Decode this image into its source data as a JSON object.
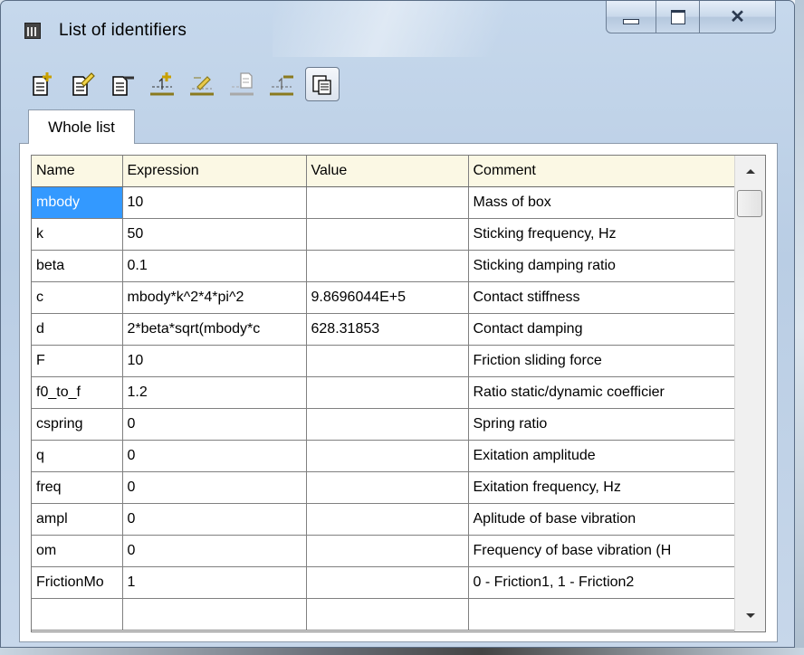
{
  "window": {
    "title": "List of identifiers",
    "controls": [
      "minimize-icon",
      "maximize-icon",
      "close-icon"
    ]
  },
  "toolbar": {
    "buttons": [
      {
        "icon": "add-document-icon"
      },
      {
        "icon": "edit-document-icon"
      },
      {
        "icon": "remove-document-icon"
      },
      {
        "icon": "add-row-icon"
      },
      {
        "icon": "edit-row-icon"
      },
      {
        "icon": "copy-row-icon"
      },
      {
        "icon": "remove-row-icon"
      },
      {
        "icon": "paste-icon",
        "pressed": true
      }
    ]
  },
  "tabs": [
    {
      "label": "Whole list"
    }
  ],
  "grid": {
    "columns": [
      "Name",
      "Expression",
      "Value",
      "Comment"
    ],
    "rows": [
      {
        "name": "mbody",
        "expression": "10",
        "value": "",
        "comment": "Mass of box",
        "selected": true
      },
      {
        "name": "k",
        "expression": "50",
        "value": "",
        "comment": "Sticking frequency, Hz"
      },
      {
        "name": "beta",
        "expression": "0.1",
        "value": "",
        "comment": "Sticking damping ratio"
      },
      {
        "name": "c",
        "expression": "mbody*k^2*4*pi^2",
        "value": "9.8696044E+5",
        "comment": "Contact stiffness"
      },
      {
        "name": "d",
        "expression": "2*beta*sqrt(mbody*c",
        "value": "628.31853",
        "comment": "Contact damping"
      },
      {
        "name": "F",
        "expression": "10",
        "value": "",
        "comment": "Friction sliding force"
      },
      {
        "name": "f0_to_f",
        "expression": "1.2",
        "value": "",
        "comment": "Ratio static/dynamic coefficier"
      },
      {
        "name": "cspring",
        "expression": "0",
        "value": "",
        "comment": "Spring ratio"
      },
      {
        "name": "q",
        "expression": "0",
        "value": "",
        "comment": "Exitation amplitude"
      },
      {
        "name": "freq",
        "expression": "0",
        "value": "",
        "comment": "Exitation frequency, Hz"
      },
      {
        "name": "ampl",
        "expression": "0",
        "value": "",
        "comment": "Aplitude of base vibration"
      },
      {
        "name": "om",
        "expression": "0",
        "value": "",
        "comment": "Frequency of base vibration (H"
      },
      {
        "name": "FrictionMo",
        "expression": "1",
        "value": "",
        "comment": "0 - Friction1, 1 - Friction2"
      },
      {
        "name": "",
        "expression": "",
        "value": "",
        "comment": ""
      }
    ]
  },
  "scrollbar": {
    "icons": [
      "scroll-up-icon",
      "scroll-down-icon"
    ]
  },
  "colors": {
    "selection": "#3399ff",
    "header_background": "#fbf8e4",
    "window_frame": "#c6d8ec"
  }
}
